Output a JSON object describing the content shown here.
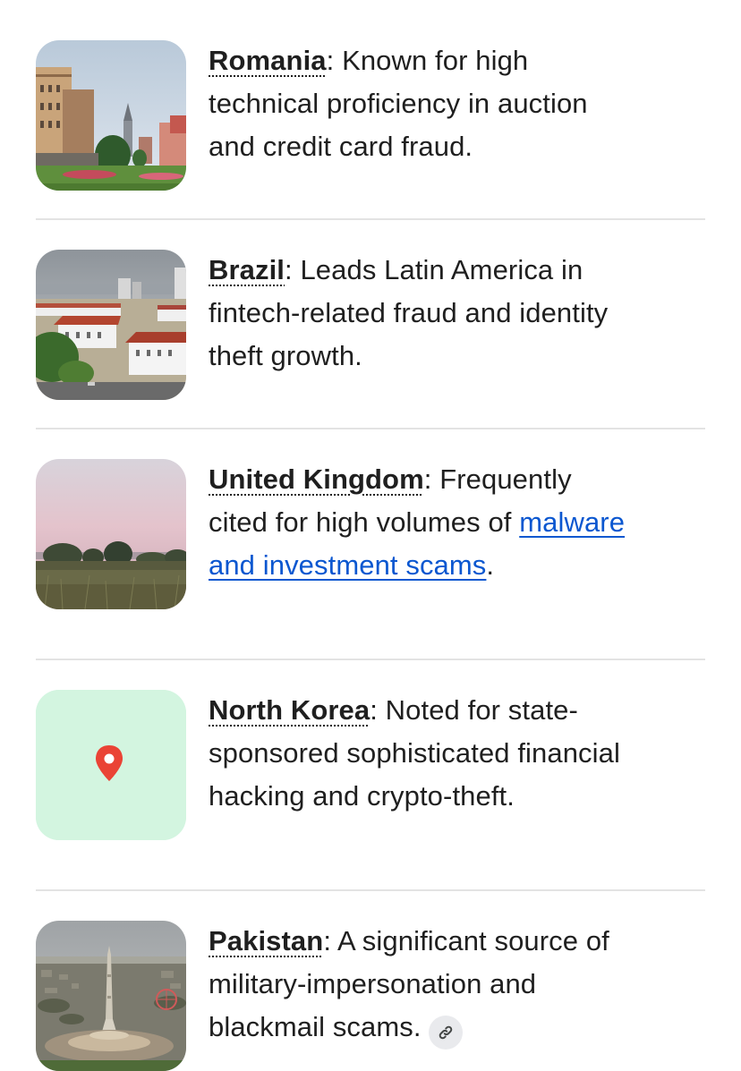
{
  "items": [
    {
      "country": "Romania",
      "separator": ": ",
      "text": "Known for high technical proficiency in auction and credit card fraud.",
      "thumbnail": "city-square-photo"
    },
    {
      "country": "Brazil",
      "separator": ": ",
      "text": "Leads Latin America in fintech-related fraud and identity theft growth.",
      "thumbnail": "city-buildings-photo"
    },
    {
      "country": "United Kingdom",
      "separator": ": ",
      "text_before": "Frequently cited for high volumes of ",
      "link": "malware and investment scams",
      "text_after": ".",
      "thumbnail": "sunset-field-photo"
    },
    {
      "country": "North Korea",
      "separator": ": ",
      "text": "Noted for state-sponsored sophisticated financial hacking and crypto-theft.",
      "thumbnail": "map-pin-icon",
      "thumbnail_bg": "#d3f5e0",
      "pin_color": "#ea4335"
    },
    {
      "country": "Pakistan",
      "separator": ": ",
      "text": "A significant source of military-impersonation and blackmail scams.",
      "thumbnail": "monument-photo",
      "source_icon": "link-icon"
    }
  ],
  "colors": {
    "text": "#1f1f1f",
    "link": "#0b57d0",
    "divider": "#e3e3e3",
    "chip": "#e9eaed"
  }
}
